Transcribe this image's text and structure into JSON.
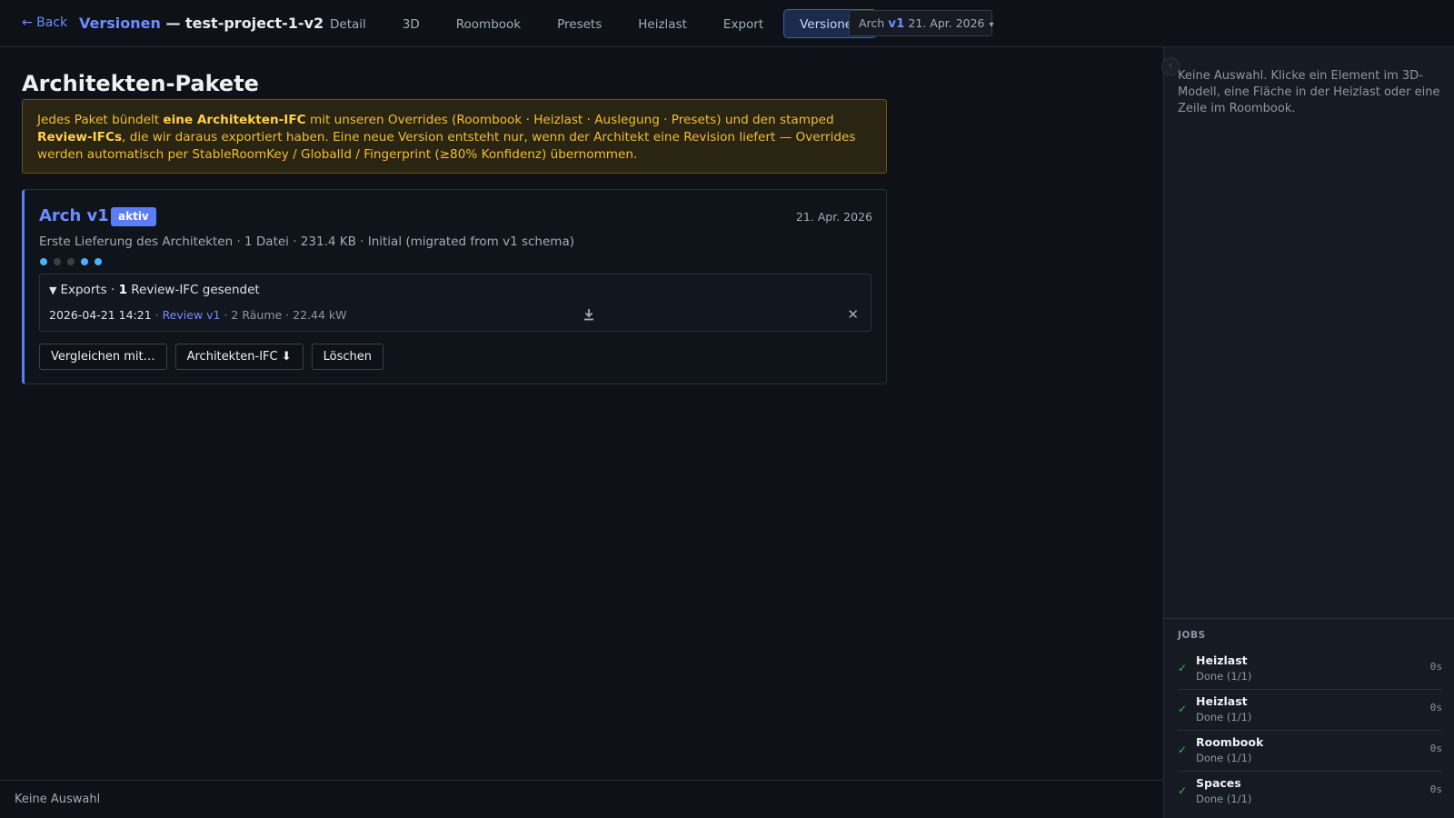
{
  "header": {
    "back_label": "← Back",
    "title_section": "Versionen",
    "title_separator": " — ",
    "title_project": "test-project-1-v2",
    "tabs": [
      {
        "label": "Detail"
      },
      {
        "label": "3D"
      },
      {
        "label": "Roombook"
      },
      {
        "label": "Presets"
      },
      {
        "label": "Heizlast"
      },
      {
        "label": "Export"
      },
      {
        "label": "Versionen",
        "active": true
      }
    ],
    "version_select": {
      "prefix": "Arch",
      "version": "v1",
      "date": "21. Apr. 2026",
      "caret": "▾"
    }
  },
  "main": {
    "heading": "Architekten-Pakete",
    "info": {
      "part1": "Jedes Paket bündelt ",
      "bold1": "eine Architekten-IFC",
      "part2": " mit unseren Overrides (Roombook · Heizlast · Auslegung · Presets) und den stamped ",
      "bold2": "Review-IFCs",
      "part3": ", die wir daraus exportiert haben. Eine neue Version entsteht nur, wenn der Architekt eine Revision liefert — Overrides werden automatisch per StableRoomKey / GlobalId / Fingerprint (≥80% Konfidenz) übernommen."
    },
    "package": {
      "title": "Arch v1",
      "badge": "aktiv",
      "date": "21. Apr. 2026",
      "meta": "Erste Lieferung des Architekten · 1 Datei · 231.4 KB · Initial (migrated from v1 schema)",
      "status_dots": [
        true,
        false,
        false,
        true,
        true
      ],
      "exports": {
        "toggle": "▼",
        "label_prefix": "Exports · ",
        "count": "1",
        "label_suffix": " Review-IFC gesendet",
        "rows": [
          {
            "timestamp": "2026-04-21 14:21",
            "link_sep": " · ",
            "link": "Review v1",
            "meta": " · 2 Räume · 22.44 kW"
          }
        ]
      },
      "actions": {
        "compare": "Vergleichen mit…",
        "ifc": "Architekten-IFC ⬇",
        "delete": "Löschen"
      }
    }
  },
  "statusbar": {
    "text": "Keine Auswahl"
  },
  "right_panel": {
    "selection_text": "Keine Auswahl. Klicke ein Element im 3D-Modell, eine Fläche in der Heizlast oder eine Zeile im Roombook.",
    "jobs_title": "JOBS",
    "jobs": [
      {
        "name": "Heizlast",
        "status": "Done (1/1)",
        "time": "0s"
      },
      {
        "name": "Heizlast",
        "status": "Done (1/1)",
        "time": "0s"
      },
      {
        "name": "Roombook",
        "status": "Done (1/1)",
        "time": "0s"
      },
      {
        "name": "Spaces",
        "status": "Done (1/1)",
        "time": "0s"
      }
    ]
  },
  "colors": {
    "accent": "#5c7cfa",
    "link": "#6f8cff",
    "warning_text": "#f2bf2e",
    "success": "#3fb950",
    "dot_active": "#49b3ff"
  }
}
